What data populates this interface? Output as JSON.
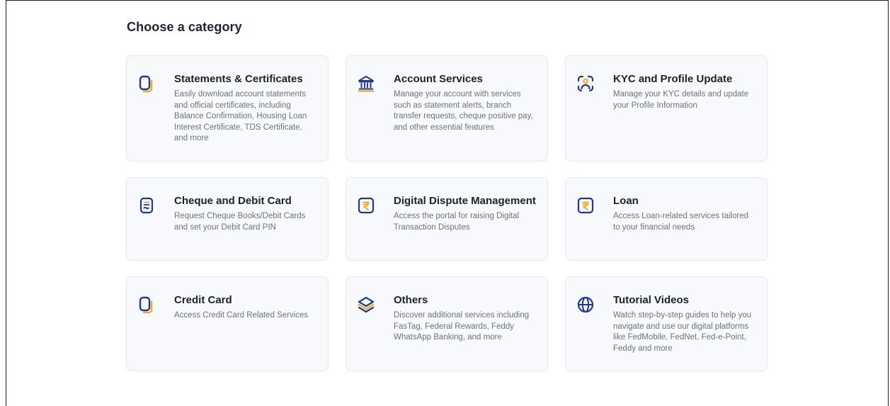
{
  "section": {
    "title": "Choose a category"
  },
  "colors": {
    "icon_primary": "#1f3a8a",
    "icon_accent": "#f5a623",
    "card_bg": "#f7f9fc",
    "card_border": "#e3e8ef"
  },
  "cards": [
    {
      "title": "Statements & Certificates",
      "description": "Easily download account statements and official certificates, including Balance Confirmation, Housing Loan Interest Certificate, TDS Certificate, and more",
      "icon": "document-icon"
    },
    {
      "title": "Account Services",
      "description": "Manage your account with services such as statement alerts, branch transfer requests, cheque positive pay, and other essential features",
      "icon": "bank-icon"
    },
    {
      "title": "KYC and Profile Update",
      "description": "Manage your KYC details and update your Profile Information",
      "icon": "face-scan-icon"
    },
    {
      "title": "Cheque and Debit Card",
      "description": "Request Cheque Books/Debit Cards and set your Debit Card PIN",
      "icon": "cheque-icon"
    },
    {
      "title": "Digital Dispute Management",
      "description": "Access the portal for raising Digital Transaction Disputes",
      "icon": "rupee-icon"
    },
    {
      "title": "Loan",
      "description": "Access Loan-related services tailored to your financial needs",
      "icon": "rupee-icon"
    },
    {
      "title": "Credit Card",
      "description": "Access Credit Card Related Services",
      "icon": "document-icon"
    },
    {
      "title": "Others",
      "description": "Discover additional services including FasTag, Federal Rewards, Feddy WhatsApp Banking, and more",
      "icon": "layers-icon"
    },
    {
      "title": "Tutorial Videos",
      "description": "Watch step-by-step guides to help you navigate and use our digital platforms like FedMobile, FedNet, Fed-e-Point, Feddy and more",
      "icon": "globe-icon"
    }
  ]
}
